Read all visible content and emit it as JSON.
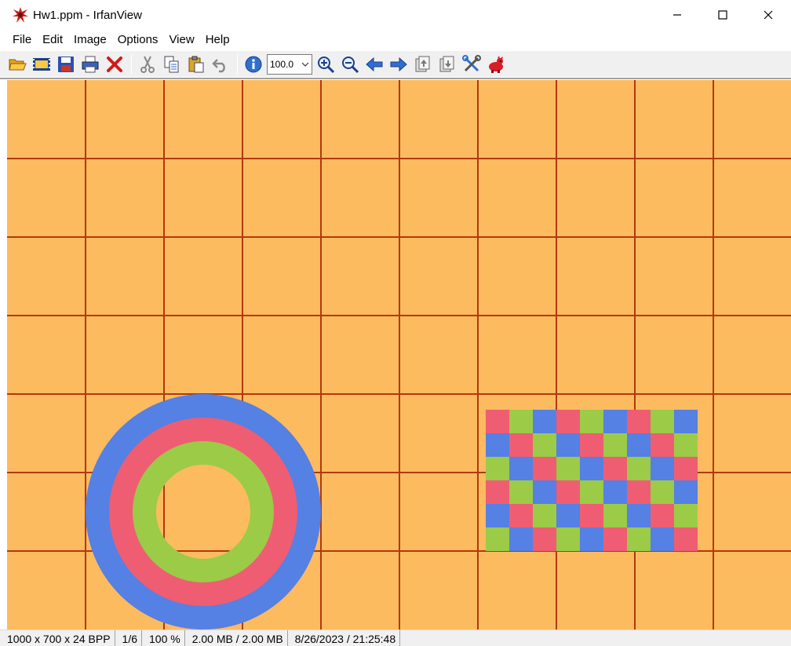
{
  "window": {
    "title": "Hw1.ppm - IrfanView"
  },
  "menu": {
    "items": [
      "File",
      "Edit",
      "Image",
      "Options",
      "View",
      "Help"
    ]
  },
  "toolbar": {
    "zoom_value": "100.0",
    "icons": [
      "open-folder-icon",
      "slideshow-icon",
      "save-icon",
      "print-icon",
      "delete-icon",
      "cut-icon",
      "copy-icon",
      "paste-icon",
      "undo-icon",
      "info-icon",
      "zoom-in-icon",
      "zoom-out-icon",
      "previous-arrow-icon",
      "next-arrow-icon",
      "first-page-icon",
      "last-page-icon",
      "properties-icon",
      "irfanview-logo-icon"
    ]
  },
  "image": {
    "background_color": "#fdbb60",
    "grid_color": "#b3380b",
    "ring_colors": [
      "#5580e4",
      "#ef5d72",
      "#9bcb47"
    ],
    "checker_colors": [
      "#ef5d72",
      "#9bcb47",
      "#5580e4"
    ],
    "checker_rows": 6,
    "checker_cols": 9
  },
  "statusbar": {
    "dimensions": "1000 x 700 x 24 BPP",
    "page": "1/6",
    "zoom": "100 %",
    "size": "2.00 MB / 2.00 MB",
    "datetime": "8/26/2023 / 21:25:48"
  },
  "colors": {
    "accent": "#2f6fd0"
  }
}
